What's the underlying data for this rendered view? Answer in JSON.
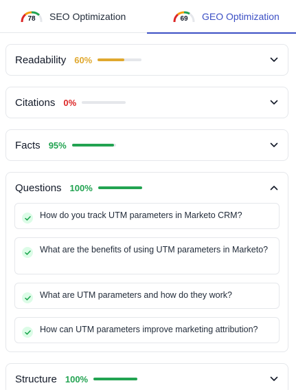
{
  "tabs": [
    {
      "label": "SEO Optimization",
      "score": "78",
      "score_value": 78,
      "active": false
    },
    {
      "label": "GEO Optimization",
      "score": "69",
      "score_value": 69,
      "active": true
    }
  ],
  "sections": [
    {
      "title": "Readability",
      "percent": "60%",
      "value": 60,
      "color": "#e0a82e",
      "expanded": false,
      "chevron": "chevron-down-icon"
    },
    {
      "title": "Citations",
      "percent": "0%",
      "value": 0,
      "color": "#dc2626",
      "expanded": false,
      "chevron": "chevron-down-icon"
    },
    {
      "title": "Facts",
      "percent": "95%",
      "value": 95,
      "color": "#22a351",
      "expanded": false,
      "chevron": "chevron-down-icon"
    },
    {
      "title": "Questions",
      "percent": "100%",
      "value": 100,
      "color": "#22a351",
      "expanded": true,
      "chevron": "chevron-up-icon",
      "items": [
        "How do you track UTM parameters in Marketo CRM?",
        "What are the benefits of using UTM parameters in Marketo?",
        "What are UTM parameters and how do they work?",
        "How can UTM parameters improve marketing attribution?"
      ]
    },
    {
      "title": "Structure",
      "percent": "100%",
      "value": 100,
      "color": "#22a351",
      "expanded": false,
      "chevron": "chevron-down-icon"
    }
  ],
  "colors": {
    "accent": "#3b4fc4",
    "good": "#22a351",
    "warn": "#e0a82e",
    "bad": "#dc2626",
    "check_bg": "#dcfce7"
  }
}
